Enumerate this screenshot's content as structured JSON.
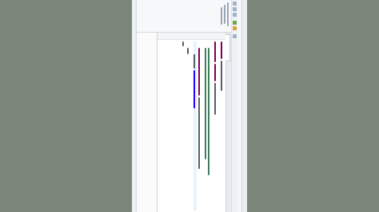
{
  "window": {
    "app_title": ""
  },
  "editor": {
    "active_tab_label": "",
    "line_count_visible": 12
  },
  "colors": {
    "background": "#7a8778",
    "keyword": "#7f0055",
    "comment": "#3f7f5f",
    "string": "#2a00ff",
    "text": "#5a5f66"
  }
}
